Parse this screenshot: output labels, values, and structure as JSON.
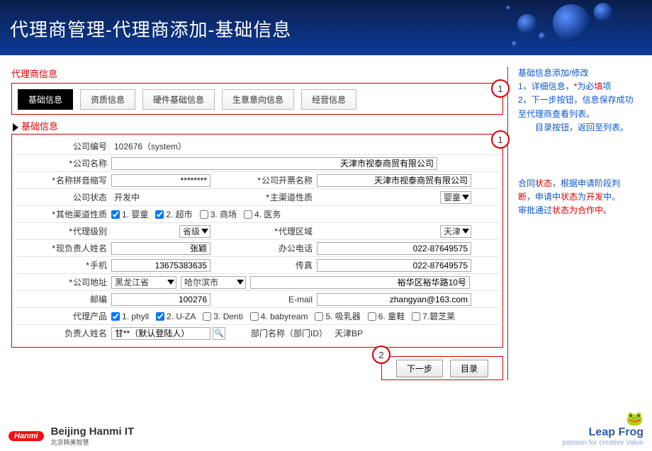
{
  "header": {
    "title": "代理商管理-代理商添加-基础信息"
  },
  "section_title": "代理商信息",
  "tabs": [
    "基础信息",
    "资质信息",
    "硬件基础信息",
    "生意意向信息",
    "经营信息"
  ],
  "form_title": "基础信息",
  "markers": {
    "tabs": "1",
    "form": "1",
    "buttons": "2"
  },
  "labels": {
    "company_no": "公司编号",
    "company_name": "公司名称",
    "name_pinyin": "名称拼音缩写",
    "invoice_name": "公司开票名称",
    "company_state": "公司状态",
    "main_channel": "主渠道性质",
    "other_channel": "其他渠道性质",
    "agent_level": "代理级别",
    "agent_area": "代理区域",
    "person": "现负责人姓名",
    "office_phone": "办公电话",
    "mobile": "手机",
    "fax": "传真",
    "company_addr": "公司地址",
    "postcode": "邮编",
    "email": "E-mail",
    "agent_product": "代理产品",
    "resp": "负责人姓名",
    "dept": "部门名称（部门ID）"
  },
  "values": {
    "company_no": "102676（system）",
    "company_name": "天津市视泰商贸有限公司",
    "name_pinyin": "********",
    "invoice_name": "天津市视泰商贸有限公司",
    "company_state": "开发中",
    "main_channel": "婴童",
    "agent_level": "省级",
    "agent_area": "天津",
    "person": "张颖",
    "office_phone": "022-87649575",
    "mobile": "13675383635",
    "fax": "022-87649575",
    "addr_prov": "黑龙江省",
    "addr_city": "哈尔滨市",
    "addr_detail": "裕华区裕华路10号",
    "postcode": "100276",
    "email": "zhangyan@163.com",
    "resp": "甘**（默认登陆人）",
    "dept": "天津BP"
  },
  "channel_opts": [
    {
      "l": "1. 婴童",
      "c": true
    },
    {
      "l": "2. 超市",
      "c": true
    },
    {
      "l": "3. 商场",
      "c": false
    },
    {
      "l": "4. 医务",
      "c": false
    }
  ],
  "product_opts": [
    {
      "l": "1. phyll",
      "c": true
    },
    {
      "l": "2. U-ZA",
      "c": true
    },
    {
      "l": "3. Denti",
      "c": false
    },
    {
      "l": "4. babyream",
      "c": false
    },
    {
      "l": "5. 吸乳器",
      "c": false
    },
    {
      "l": "6. 童鞋",
      "c": false
    },
    {
      "l": "7.碧芝莱",
      "c": false
    }
  ],
  "buttons": {
    "next": "下一步",
    "list": "目录"
  },
  "side": {
    "t1": "基础信息添加/修改",
    "l1a": "1，详细信息，",
    "l1b": "为必",
    "l1c": "填",
    "l1d": "项",
    "l2": "2，下一步按钮，信息保存成功至代理商查看列表。",
    "l3": "　　目录按钮，返回至列表。",
    "p2a": "合同",
    "p2b": "状态",
    "p2c": "，根据申请阶段判",
    "p2d": "断",
    "p2e": "，申请中",
    "p2f": "状态",
    "p2g": "为",
    "p2h": "开发",
    "p2i": "中。",
    "p3a": "审批通过",
    "p3b": "状态为",
    "p3c": "合作中。",
    "star": "*"
  },
  "footer": {
    "hanmi": "Hanmi",
    "bj": "Beijing Hanmi IT",
    "bj_sub": "北京韩美智慧",
    "frog": "Leap Frog",
    "tag": "passion for creative Value"
  }
}
